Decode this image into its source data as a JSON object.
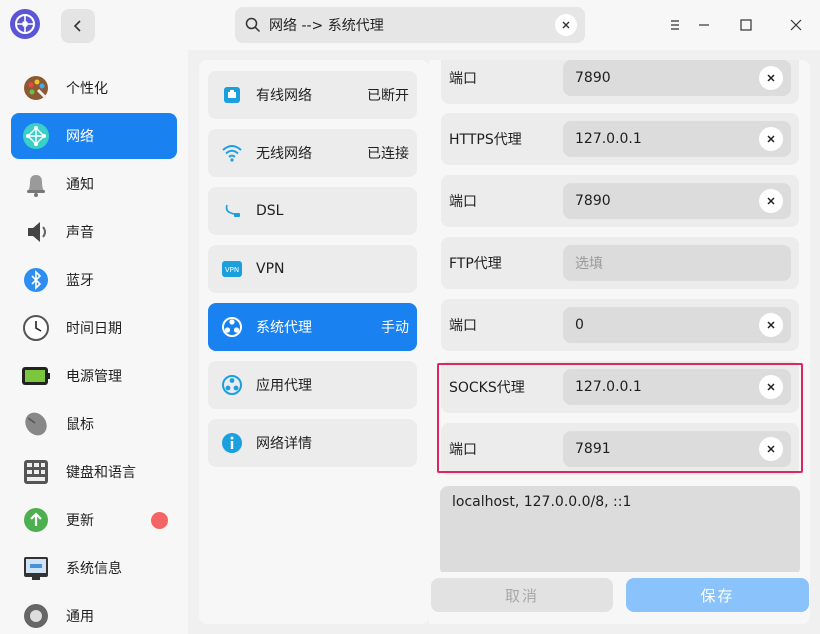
{
  "titlebar": {
    "search_text": "网络 --> 系统代理"
  },
  "leftnav": {
    "items": [
      {
        "label": "个性化",
        "icon": "palette-icon"
      },
      {
        "label": "网络",
        "icon": "network-icon"
      },
      {
        "label": "通知",
        "icon": "bell-icon"
      },
      {
        "label": "声音",
        "icon": "speaker-icon"
      },
      {
        "label": "蓝牙",
        "icon": "bluetooth-icon"
      },
      {
        "label": "时间日期",
        "icon": "clock-icon"
      },
      {
        "label": "电源管理",
        "icon": "battery-icon"
      },
      {
        "label": "鼠标",
        "icon": "mouse-icon"
      },
      {
        "label": "键盘和语言",
        "icon": "keyboard-icon"
      },
      {
        "label": "更新",
        "icon": "update-icon"
      },
      {
        "label": "系统信息",
        "icon": "system-info-icon"
      },
      {
        "label": "通用",
        "icon": "general-icon"
      }
    ],
    "active": "网络"
  },
  "midpanel": {
    "items": [
      {
        "label": "有线网络",
        "status": "已断开",
        "icon": "wired-network-icon"
      },
      {
        "label": "无线网络",
        "status": "已连接",
        "icon": "wifi-icon"
      },
      {
        "label": "DSL",
        "status": "",
        "icon": "dsl-icon"
      },
      {
        "label": "VPN",
        "status": "",
        "icon": "vpn-icon"
      },
      {
        "label": "系统代理",
        "status": "手动",
        "icon": "system-proxy-icon"
      },
      {
        "label": "应用代理",
        "status": "",
        "icon": "app-proxy-icon"
      },
      {
        "label": "网络详情",
        "status": "",
        "icon": "info-icon"
      }
    ],
    "active": "系统代理"
  },
  "proxy": {
    "rows": [
      {
        "label": "端口",
        "value": "7890",
        "placeholder": ""
      },
      {
        "label": "HTTPS代理",
        "value": "127.0.0.1",
        "placeholder": ""
      },
      {
        "label": "端口",
        "value": "7890",
        "placeholder": ""
      },
      {
        "label": "FTP代理",
        "value": "",
        "placeholder": "选填"
      },
      {
        "label": "端口",
        "value": "0",
        "placeholder": ""
      },
      {
        "label": "SOCKS代理",
        "value": "127.0.0.1",
        "placeholder": ""
      },
      {
        "label": "端口",
        "value": "7891",
        "placeholder": ""
      }
    ],
    "ignore_hosts": "localhost, 127.0.0.0/8, ::1",
    "cancel_label": "取消",
    "save_label": "保存"
  },
  "colors": {
    "accent": "#1a82f0",
    "highlight_border": "#e0245e",
    "update_dot": "#f56464"
  }
}
